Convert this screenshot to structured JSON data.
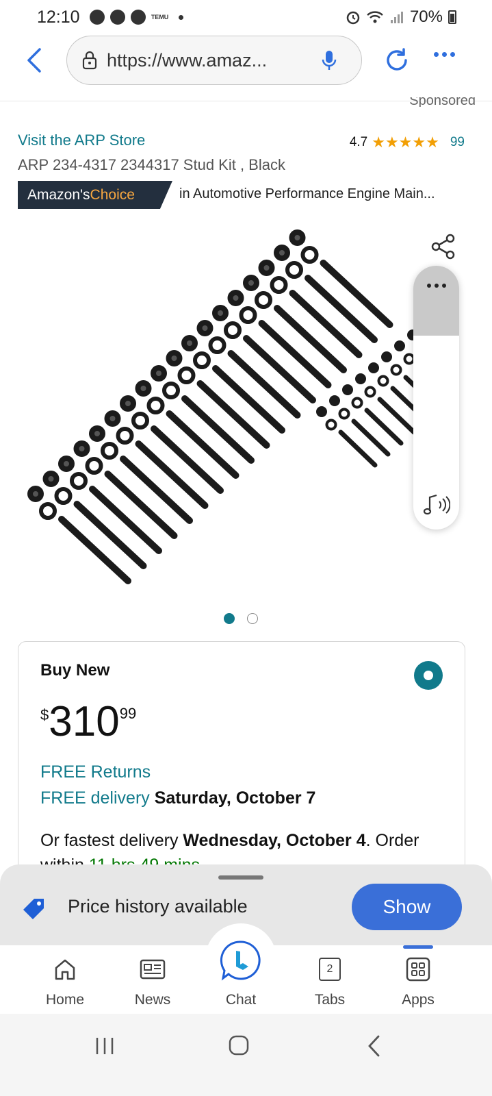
{
  "status_bar": {
    "time": "12:10",
    "temu_label": "TEMU",
    "battery": "70%"
  },
  "browser": {
    "url": "https://www.amazon.com/ARP-234-4317-2344317-Stud-Black",
    "url_display": "https://www.amaz..."
  },
  "product": {
    "sponsored": "Sponsored",
    "store_link": "Visit the ARP Store",
    "rating_value": "4.7",
    "rating_stars": "★★★★★",
    "rating_count": "99",
    "title": "ARP 234-4317 2344317 Stud Kit , Black",
    "badge_part1": "Amazon's ",
    "badge_part2": "Choice",
    "badge_category": "in Automotive Performance Engine Main...",
    "image_page": 1,
    "image_count": 2
  },
  "buy_box": {
    "title": "Buy New",
    "price_symbol": "$",
    "price_whole": "310",
    "price_fraction": "99",
    "free_returns": "FREE Returns",
    "free_delivery_label": "FREE delivery",
    "free_delivery_date": "Saturday, October 7",
    "fastest_prefix": "Or fastest delivery ",
    "fastest_date": "Wednesday, October 4",
    "fastest_suffix": ". Order within ",
    "countdown": "11 hrs 49 mins"
  },
  "price_history": {
    "text": "Price history available",
    "button": "Show"
  },
  "bottom_nav": {
    "home": "Home",
    "news": "News",
    "chat": "Chat",
    "tabs": "Tabs",
    "tabs_count": "2",
    "apps": "Apps"
  },
  "colors": {
    "link_teal": "#117a8b",
    "accent_blue": "#3a6fd8",
    "star_orange": "#f29f05",
    "badge_dark": "#232f3e"
  }
}
